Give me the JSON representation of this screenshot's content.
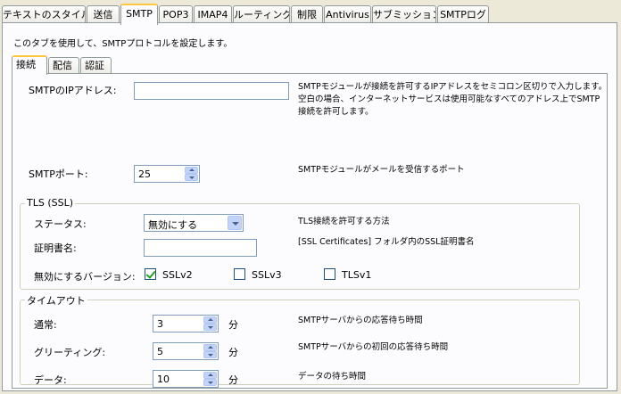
{
  "tabs": [
    "テキストのスタイル",
    "送信",
    "SMTP",
    "POP3",
    "IMAP4",
    "ルーティング",
    "制限",
    "Antivirus",
    "サブミッション",
    "SMTPログ"
  ],
  "active_tab": "SMTP",
  "description": "このタブを使用して、SMTPプロトコルを設定します。",
  "subtabs": [
    "接続",
    "配信",
    "認証"
  ],
  "active_subtab": "接続",
  "ip": {
    "label": "SMTPのIPアドレス:",
    "value": "",
    "help": [
      "SMTPモジュールが接続を許可するIPアドレスをセミコロン区切りで入力します。",
      "空白の場合、インターネットサービスは使用可能なすべてのアドレス上でSMTP",
      "接続を許可します。"
    ]
  },
  "port": {
    "label": "SMTPポート:",
    "value": "25",
    "help": "SMTPモジュールがメールを受信するポート"
  },
  "tls": {
    "title": "TLS (SSL)",
    "status_label": "ステータス:",
    "status_value": "無効にする",
    "status_help": "TLS接続を許可する方法",
    "cert_label": "証明書名:",
    "cert_value": "",
    "cert_help": "[SSL Certificates] フォルダ内のSSL証明書名",
    "disabled_label": "無効にするバージョン:",
    "versions": [
      {
        "label": "SSLv2",
        "checked": true
      },
      {
        "label": "SSLv3",
        "checked": false
      },
      {
        "label": "TLSv1",
        "checked": false
      }
    ]
  },
  "timeout": {
    "title": "タイムアウト",
    "unit": "分",
    "rows": [
      {
        "label": "通常:",
        "value": "3",
        "help": "SMTPサーバからの応答待ち時間"
      },
      {
        "label": "グリーティング:",
        "value": "5",
        "help": "SMTPサーバからの初回の応答待ち時間"
      },
      {
        "label": "データ:",
        "value": "10",
        "help": "データの待ち時間"
      }
    ]
  }
}
